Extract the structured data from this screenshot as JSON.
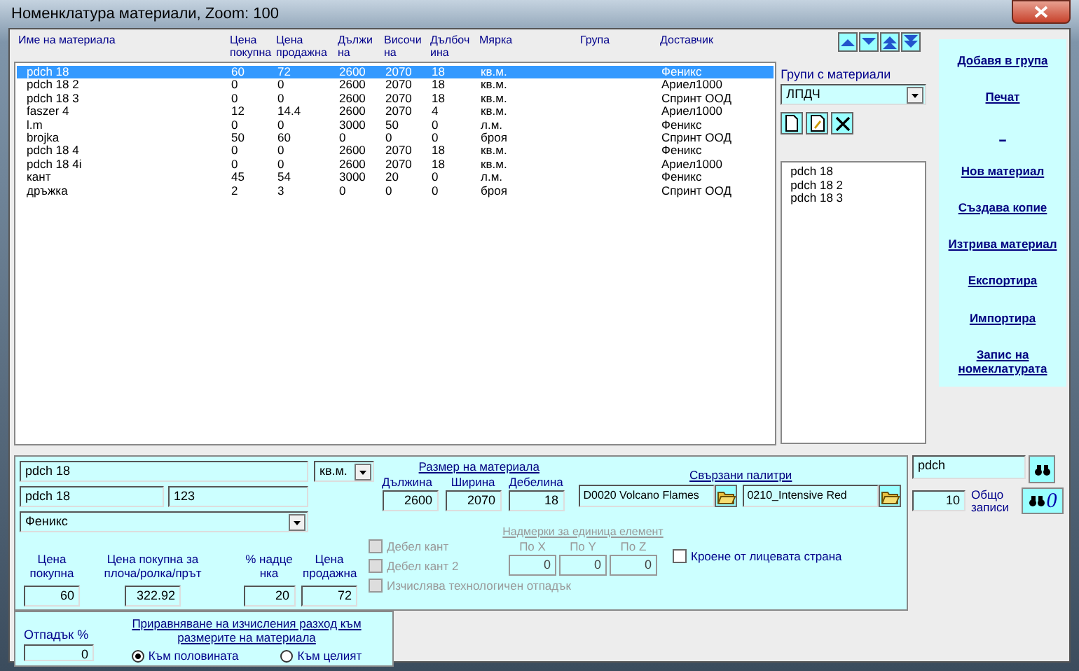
{
  "window": {
    "title": "Номенклатура материали,  Zoom:  100"
  },
  "table": {
    "columns": [
      "Име на материала",
      "Цена покупна",
      "Цена продажна",
      "Дължи на",
      "Височи на",
      "Дълбоч ина",
      "Мярка",
      "Група",
      "Доставчик"
    ],
    "rows": [
      {
        "cells": [
          "pdch 18",
          "60",
          "72",
          "2600",
          "2070",
          "18",
          "кв.м.",
          "",
          "Феникс"
        ],
        "selected": true
      },
      {
        "cells": [
          "pdch 18 2",
          "0",
          "0",
          "2600",
          "2070",
          "18",
          "кв.м.",
          "",
          "Ариел1000"
        ],
        "selected": false
      },
      {
        "cells": [
          "pdch 18 3",
          "0",
          "0",
          "2600",
          "2070",
          "18",
          "кв.м.",
          "",
          "Спринт ООД"
        ],
        "selected": false
      },
      {
        "cells": [
          "faszer 4",
          "12",
          "14.4",
          "2600",
          "2070",
          "4",
          "кв.м.",
          "",
          "Ариел1000"
        ],
        "selected": false
      },
      {
        "cells": [
          "l.m",
          "0",
          "0",
          "3000",
          "50",
          "0",
          "л.м.",
          "",
          "Феникс"
        ],
        "selected": false
      },
      {
        "cells": [
          "brojka",
          "50",
          "60",
          "0",
          "0",
          "0",
          "броя",
          "",
          "Спринт ООД"
        ],
        "selected": false
      },
      {
        "cells": [
          "pdch 18 4",
          "0",
          "0",
          "2600",
          "2070",
          "18",
          "кв.м.",
          "",
          "Феникс"
        ],
        "selected": false
      },
      {
        "cells": [
          "pdch 18 4i",
          "0",
          "0",
          "2600",
          "2070",
          "18",
          "кв.м.",
          "",
          "Ариел1000"
        ],
        "selected": false
      },
      {
        "cells": [
          "кант",
          "45",
          "54",
          "3000",
          "20",
          "0",
          "л.м.",
          "",
          "Феникс"
        ],
        "selected": false
      },
      {
        "cells": [
          "дръжка",
          "2",
          "3",
          "0",
          "0",
          "0",
          "броя",
          "",
          "Спринт ООД"
        ],
        "selected": false
      }
    ]
  },
  "groups": {
    "label": "Групи с материали",
    "dropdown": "ЛПДЧ",
    "items": [
      "pdch 18",
      "pdch 18 2",
      "pdch 18 3"
    ]
  },
  "actions": [
    "Добавя в група",
    "Печат",
    "_",
    "Нов материал",
    "Създава копие",
    "Изтрива материал",
    "Експортира",
    "Импортира",
    "Запис на номеклатурата"
  ],
  "form": {
    "name": "pdch 18",
    "unit": "кв.м.",
    "code": "pdch 18",
    "code_2": "123",
    "supplier": "Феникс",
    "size": {
      "title": "Размер на материала",
      "fields": [
        {
          "label": "Дължина",
          "value": "2600"
        },
        {
          "label": "Ширина",
          "value": "2070"
        },
        {
          "label": "Дебелина",
          "value": "18"
        }
      ]
    },
    "palettes": {
      "title": "Свързани палитри",
      "items": [
        "D0020 Volcano Flames",
        "0210_Intensive Red"
      ]
    },
    "prices": [
      {
        "label": "Цена покупна",
        "value": "60"
      },
      {
        "label": "Цена покупна за плоча/ролка/прът",
        "value": "322.92"
      },
      {
        "label": "% надце нка",
        "value": "20"
      },
      {
        "label": "Цена продажна",
        "value": "72"
      }
    ],
    "checkboxes": [
      {
        "label": "Дебел кант",
        "checked": false,
        "disabled": true
      },
      {
        "label": "Дебел кант 2",
        "checked": false,
        "disabled": true
      },
      {
        "label": "Изчислява технологичен отпадък",
        "checked": false,
        "disabled": true
      }
    ],
    "allowances": {
      "title": "Надмерки за единица елемент",
      "disabled": true,
      "fields": [
        {
          "label": "По X",
          "value": "0"
        },
        {
          "label": "По Y",
          "value": "0"
        },
        {
          "label": "По Z",
          "value": "0"
        }
      ]
    },
    "face_cut": {
      "label": "Кроене от лицевата страна",
      "checked": false
    }
  },
  "waste": {
    "label": "Отпадък %",
    "value": "0",
    "link": "Приравняване на изчисления разход към размерите на материала",
    "options": [
      {
        "label": "Към половината",
        "selected": true
      },
      {
        "label": "Към целият",
        "selected": false
      }
    ]
  },
  "search": {
    "value": "pdch",
    "count": "10",
    "count_label": "Общо записи",
    "reset_label": "0"
  }
}
